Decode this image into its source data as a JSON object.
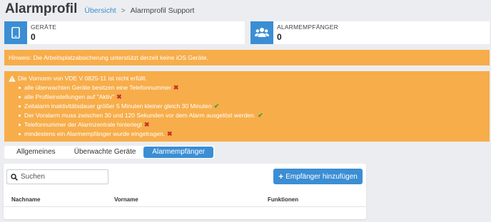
{
  "header": {
    "title": "Alarmprofil",
    "breadcrumb": {
      "link": "Übersicht",
      "separator": ">",
      "current": "Alarmprofil Support"
    }
  },
  "stats": {
    "devices": {
      "label": "GERÄTE",
      "value": "0",
      "icon": "phone-icon"
    },
    "recipients": {
      "label": "ALARMEMPFÄNGER",
      "value": "0",
      "icon": "users-icon"
    }
  },
  "hint": {
    "text": "Hinweis: Die Arbeitsplatzabsicherung unterstützt derzeit keine iOS Geräte."
  },
  "warning": {
    "title": "Die Vornorm von VDE V 0825-11 ist nicht erfüllt.",
    "items": [
      {
        "text": "alle überwachten Geräte besitzen eine Telefonnummer",
        "status": "fail",
        "mark": "✖"
      },
      {
        "text": "alle Profileinstellungen auf \"Aktiv\"",
        "status": "fail",
        "mark": "✖"
      },
      {
        "text": "Zeitalarm inaktivitätsdauer größer 5 Minuten kleiner gleich 30 Minuten",
        "status": "ok",
        "mark": "✔"
      },
      {
        "text": "Der Voralarm muss zwischen 30 und 120 Sekunden vor dem Alarm ausgelöst werden.",
        "status": "ok",
        "mark": "✔"
      },
      {
        "text": "Telefonnummer der Alarmzentrale hinterlegt",
        "status": "fail",
        "mark": "✖"
      },
      {
        "text": "mindestens ein Alarmempfänger wurde eingetragen.",
        "status": "fail",
        "mark": "✖"
      }
    ]
  },
  "tabs": [
    {
      "label": "Allgemeines",
      "active": false
    },
    {
      "label": "Überwachte Geräte",
      "active": false
    },
    {
      "label": "Alarmempfänger",
      "active": true
    }
  ],
  "panel": {
    "search_placeholder": "Suchen",
    "search_value": "",
    "add_button": {
      "plus": "+",
      "label": "Empfänger hinzufügen"
    },
    "columns": [
      "Nachname",
      "Vorname",
      "Funktionen"
    ]
  },
  "colors": {
    "accent": "#3b8ed4",
    "warning": "#f7ad4a",
    "fail": "#c9302c",
    "ok": "#3aa33a",
    "background": "#ecedf0"
  }
}
